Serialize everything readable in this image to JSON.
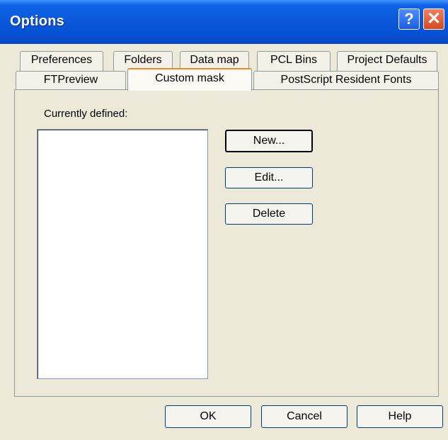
{
  "window": {
    "title": "Options",
    "help_icon": "?",
    "close_icon": "✕"
  },
  "tabs": {
    "row1": [
      "Preferences",
      "Folders",
      "Data map",
      "PCL Bins",
      "Project Defaults"
    ],
    "row2": [
      "FTPreview",
      "Custom mask",
      "PostScript Resident Fonts"
    ],
    "active": "Custom mask"
  },
  "custom_mask": {
    "list_label": "Currently defined:",
    "items": [],
    "new_label": "New...",
    "edit_label": "Edit...",
    "delete_label": "Delete"
  },
  "footer": {
    "ok_label": "OK",
    "cancel_label": "Cancel",
    "help_label": "Help"
  },
  "colors": {
    "dialog_bg": "#ece9d8",
    "titlebar": "#0a58dc",
    "close_button": "#d8481f",
    "active_tab_highlight": "#e68b2c"
  }
}
